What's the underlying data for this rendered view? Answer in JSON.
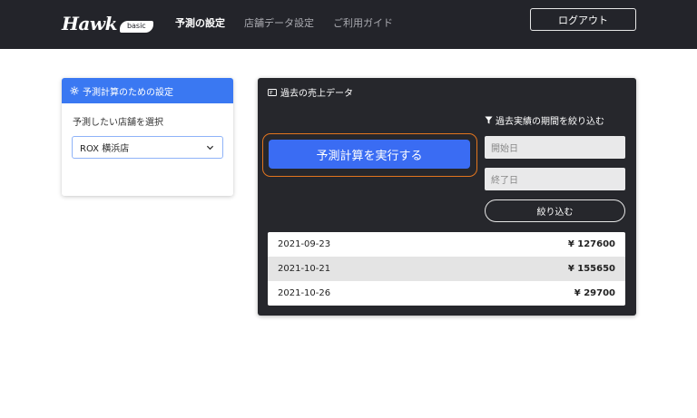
{
  "header": {
    "logo_word": "Hawk",
    "logo_badge": "basic",
    "nav": [
      {
        "label": "予測の設定",
        "active": true
      },
      {
        "label": "店舗データ設定",
        "active": false
      },
      {
        "label": "ご利用ガイド",
        "active": false
      }
    ],
    "logout_label": "ログアウト"
  },
  "settings": {
    "title": "予測計算のための設定",
    "store_label": "予測したい店舗を選択",
    "store_selected": "ROX 横浜店"
  },
  "data_panel": {
    "title": "過去の売上データ",
    "run_button": "予測計算を実行する",
    "filter_title": "過去実績の期間を絞り込む",
    "start_placeholder": "開始日",
    "end_placeholder": "終了日",
    "filter_button": "絞り込む",
    "rows": [
      {
        "date": "2021-09-23",
        "amount": "¥ 127600"
      },
      {
        "date": "2021-10-21",
        "amount": "¥ 155650"
      },
      {
        "date": "2021-10-26",
        "amount": "¥ 29700"
      }
    ]
  },
  "colors": {
    "header_bg": "#23242a",
    "accent_blue": "#3a78f2",
    "run_button_blue": "#3a6cf3",
    "highlight_orange": "#e2751e",
    "panel_bg": "#26272c"
  },
  "icons": [
    "gear-icon",
    "card-icon",
    "filter-icon",
    "chevron-down-icon"
  ]
}
